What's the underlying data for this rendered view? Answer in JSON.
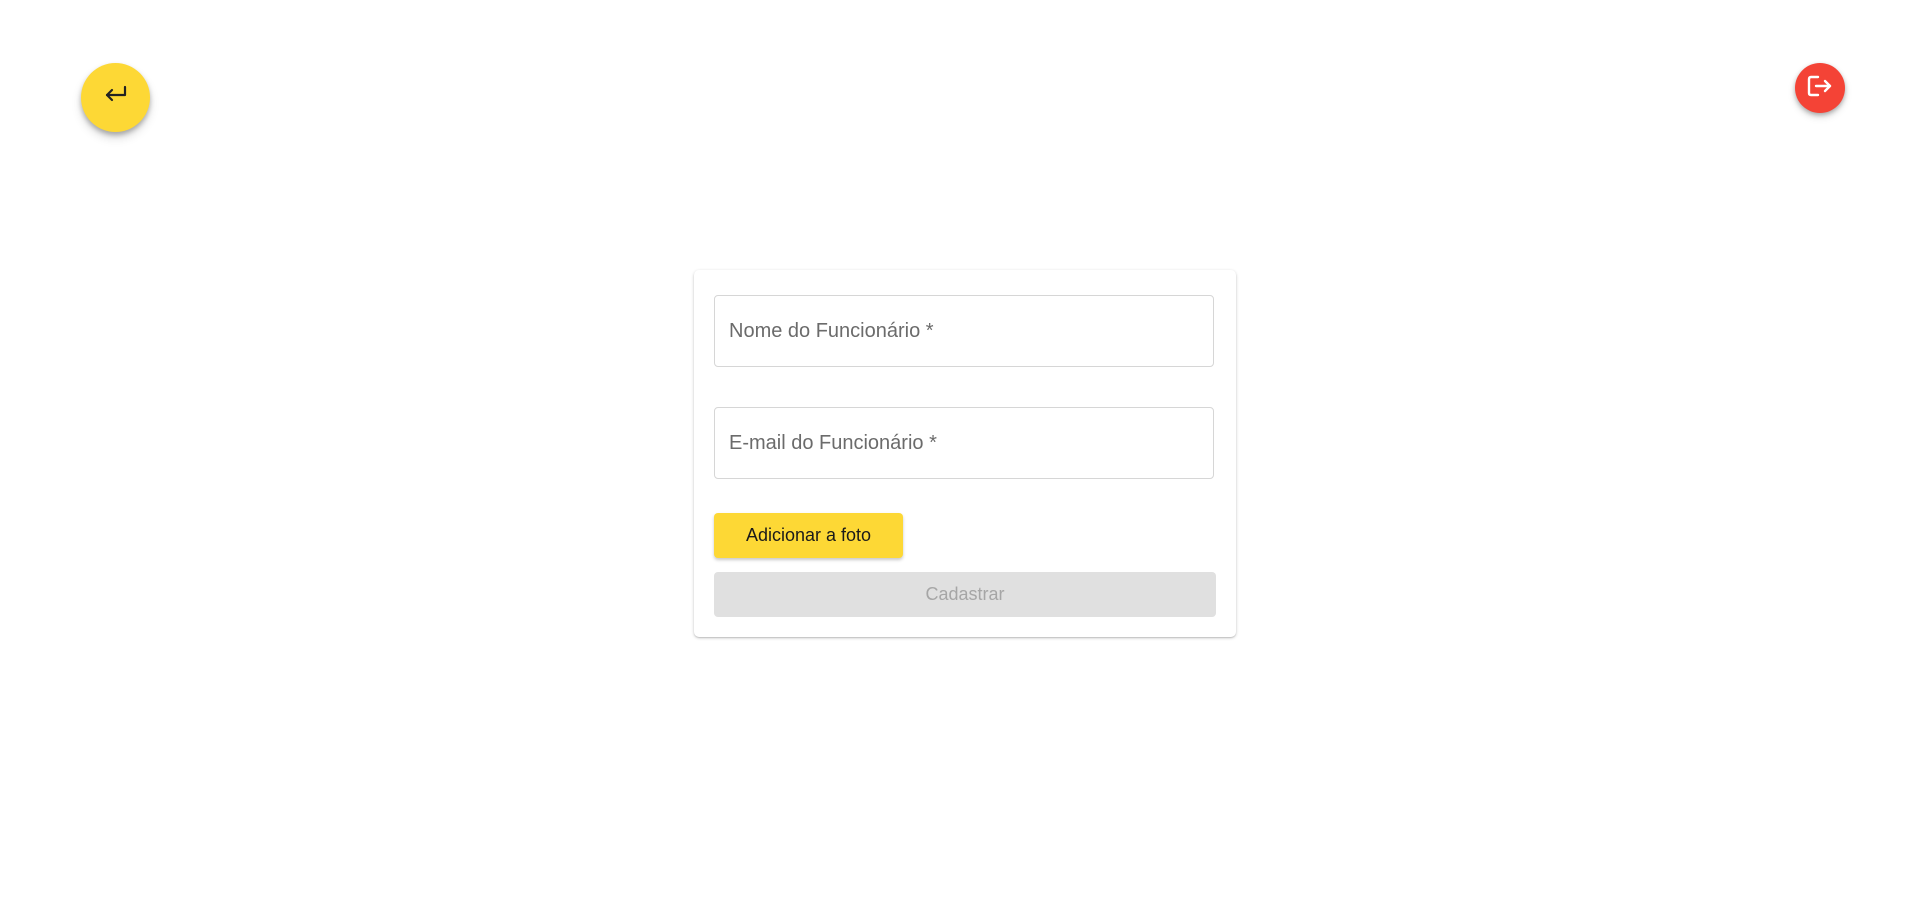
{
  "nav": {
    "back_icon": "return-arrow-icon",
    "back_color": "#fdd835",
    "logout_icon": "logout-icon",
    "logout_color": "#f44336"
  },
  "form": {
    "name_field": {
      "label": "Nome do Funcionário *",
      "value": ""
    },
    "email_field": {
      "label": "E-mail do Funcionário *",
      "value": ""
    },
    "add_photo_label": "Adicionar a foto",
    "submit_label": "Cadastrar",
    "submit_disabled": true
  },
  "colors": {
    "accent": "#fdd835",
    "danger": "#f44336",
    "disabled_bg": "#e0e0e0",
    "disabled_text": "#a6a6a6"
  }
}
